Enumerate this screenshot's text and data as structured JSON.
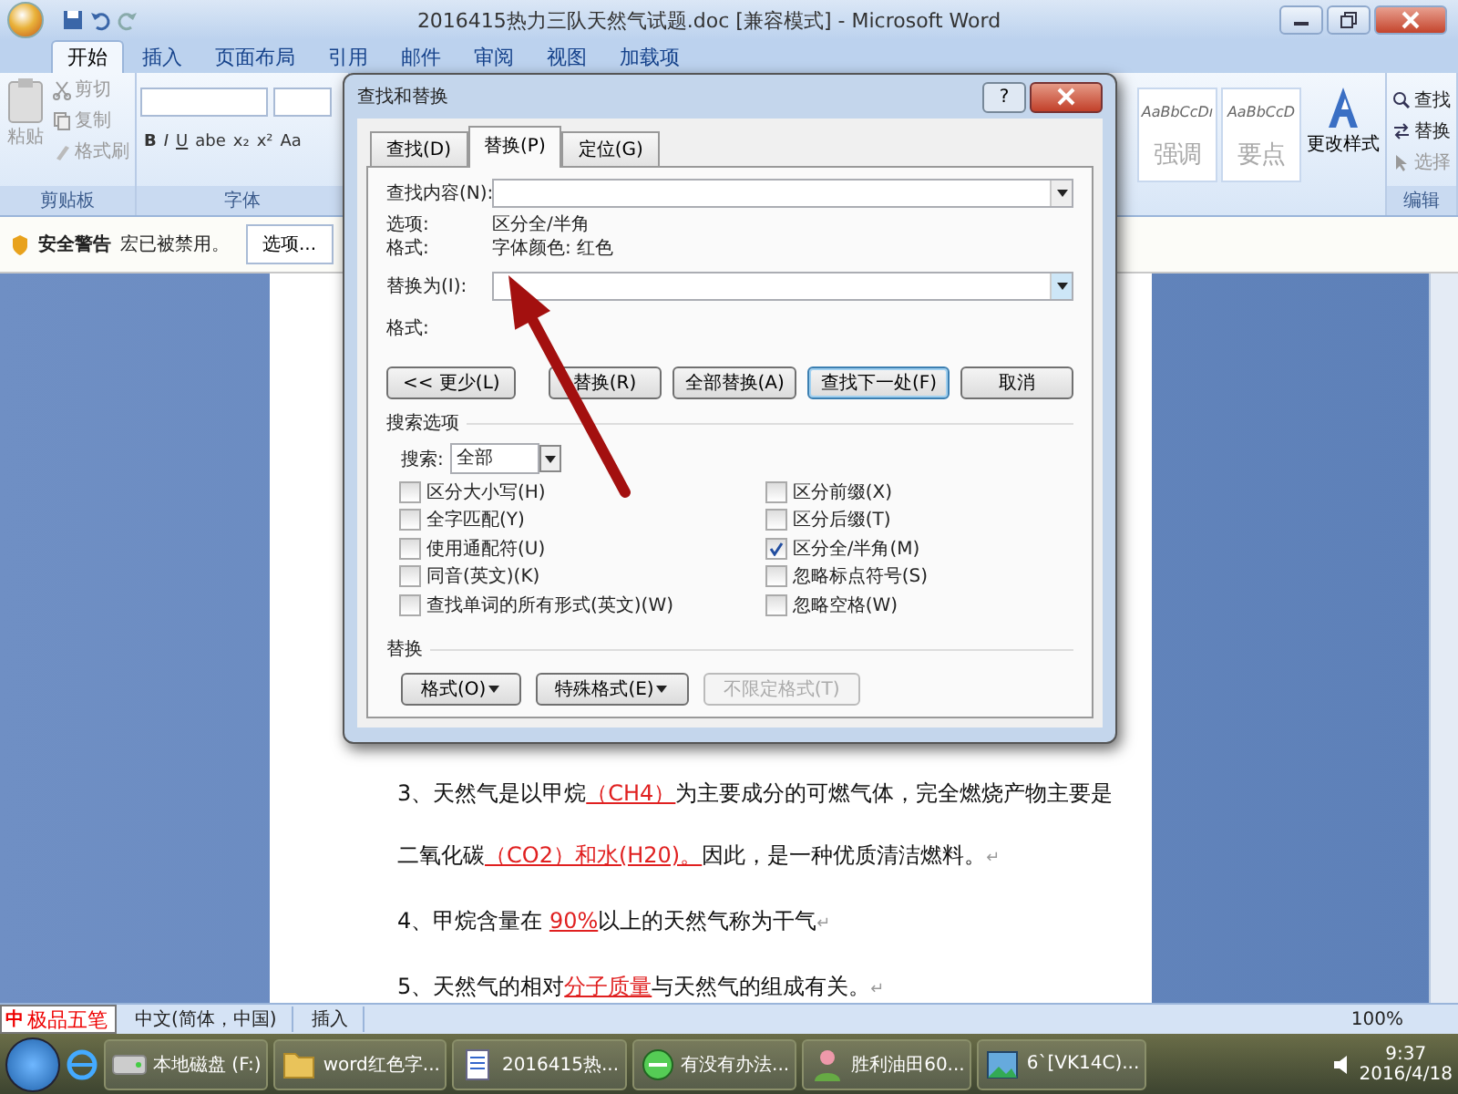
{
  "window": {
    "title": "2016415热力三队天然气试题.doc [兼容模式] - Microsoft Word"
  },
  "ribbon_tabs": [
    {
      "label": "开始",
      "selected": true
    },
    {
      "label": "插入",
      "selected": false
    },
    {
      "label": "页面布局",
      "selected": false
    },
    {
      "label": "引用",
      "selected": false
    },
    {
      "label": "邮件",
      "selected": false
    },
    {
      "label": "审阅",
      "selected": false
    },
    {
      "label": "视图",
      "selected": false
    },
    {
      "label": "加载项",
      "selected": false
    }
  ],
  "clipboard": {
    "paste": "粘贴",
    "items": [
      {
        "label": "剪切",
        "disabled": true
      },
      {
        "label": "复制",
        "disabled": true
      },
      {
        "label": "格式刷",
        "disabled": true
      }
    ],
    "label": "剪贴板"
  },
  "font": {
    "format_buttons": [
      "B",
      "I",
      "U",
      "abe",
      "x₂",
      "x²",
      "Aa"
    ],
    "label": "字体"
  },
  "styles": [
    {
      "sample": "AaBbCcDı",
      "name": "强调"
    },
    {
      "sample": "AaBbCcD",
      "name": "要点"
    }
  ],
  "change_styles": "更改样式",
  "editing": {
    "items": [
      {
        "label": "查找",
        "disabled": false
      },
      {
        "label": "替换",
        "disabled": false
      },
      {
        "label": "选择",
        "disabled": true
      }
    ],
    "label": "编辑"
  },
  "security_bar": {
    "title": "安全警告",
    "message": "宏已被禁用。",
    "button": "选项..."
  },
  "dialog": {
    "title": "查找和替换",
    "help": "?",
    "tabs": [
      {
        "label": "查找(D)",
        "selected": false
      },
      {
        "label": "替换(P)",
        "selected": true
      },
      {
        "label": "定位(G)",
        "selected": false
      }
    ],
    "find_label": "查找内容(N):",
    "options_label": "选项:",
    "options_value": "区分全/半角",
    "format_label": "格式:",
    "format_value": "字体颜色: 红色",
    "replace_label": "替换为(I):",
    "replace_format_label": "格式:",
    "buttons": [
      {
        "label": "<< 更少(L)",
        "kind": "left",
        "default": false
      },
      {
        "label": "替换(R)",
        "kind": "right",
        "default": false
      },
      {
        "label": "全部替换(A)",
        "kind": "right",
        "default": false
      },
      {
        "label": "查找下一处(F)",
        "kind": "right",
        "default": true
      },
      {
        "label": "取消",
        "kind": "right",
        "default": false
      }
    ],
    "search_options_title": "搜索选项",
    "search_label": "搜索:",
    "search_value": "全部",
    "left_options": [
      {
        "label": "区分大小写(H)",
        "checked": false
      },
      {
        "label": "全字匹配(Y)",
        "checked": false
      },
      {
        "label": "使用通配符(U)",
        "checked": false
      },
      {
        "label": "同音(英文)(K)",
        "checked": false
      },
      {
        "label": "查找单词的所有形式(英文)(W)",
        "checked": false
      }
    ],
    "right_options": [
      {
        "label": "区分前缀(X)",
        "checked": false
      },
      {
        "label": "区分后缀(T)",
        "checked": false
      },
      {
        "label": "区分全/半角(M)",
        "checked": true
      },
      {
        "label": "忽略标点符号(S)",
        "checked": false
      },
      {
        "label": "忽略空格(W)",
        "checked": false
      }
    ],
    "replace_section_title": "替换",
    "replace_buttons": [
      {
        "label": "格式(O)",
        "dropdown": true,
        "disabled": false
      },
      {
        "label": "特殊格式(E)",
        "dropdown": true,
        "disabled": false
      },
      {
        "label": "不限定格式(T)",
        "dropdown": false,
        "disabled": true
      }
    ]
  },
  "document": {
    "paragraphs": [
      {
        "segments": [
          {
            "kind": "text",
            "text": "3、天然气是以甲烷"
          },
          {
            "kind": "answer",
            "text": "（CH4）"
          },
          {
            "kind": "text",
            "text": "为主要成分的可燃气体，完全燃烧产物主要是"
          }
        ]
      },
      {
        "segments": [
          {
            "kind": "text",
            "text": "二氧化碳"
          },
          {
            "kind": "answer",
            "text": "（CO2）和水(H20)。"
          },
          {
            "kind": "text",
            "text": "因此，是一种优质清洁燃料。"
          },
          {
            "kind": "mark",
            "text": "↵"
          }
        ]
      },
      {
        "segments": [
          {
            "kind": "text",
            "text": "4、甲烷含量在 "
          },
          {
            "kind": "answer",
            "text": "90%"
          },
          {
            "kind": "text",
            "text": "以上的天然气称为干气"
          },
          {
            "kind": "mark",
            "text": "↵"
          }
        ]
      },
      {
        "segments": [
          {
            "kind": "text",
            "text": "5、天然气的相对"
          },
          {
            "kind": "answer",
            "text": "分子质量"
          },
          {
            "kind": "text",
            "text": "与天然气的组成有关。"
          },
          {
            "kind": "mark",
            "text": "↵"
          }
        ]
      }
    ]
  },
  "status_bar": {
    "ime_badge": "中",
    "ime": "极品五笔",
    "language": "中文(简体，中国)",
    "mode": "插入",
    "zoom": "100%"
  },
  "taskbar": {
    "tasks": [
      {
        "label": "本地磁盘 (F:)"
      },
      {
        "label": "word红色字..."
      },
      {
        "label": "2016415热..."
      },
      {
        "label": "有没有办法..."
      },
      {
        "label": "胜利油田60..."
      },
      {
        "label": "6`[VK14C)..."
      }
    ],
    "time": "9:37",
    "date": "2016/4/18"
  }
}
